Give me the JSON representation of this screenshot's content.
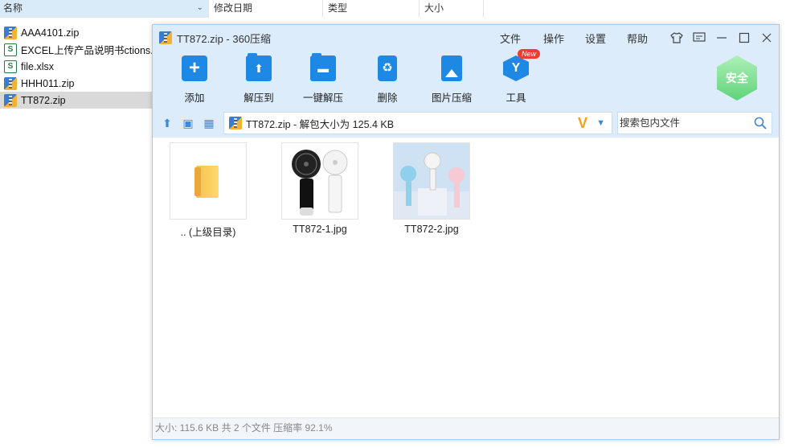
{
  "explorer": {
    "columns": {
      "name": "名称",
      "date": "修改日期",
      "type": "类型",
      "size": "大小"
    },
    "files": [
      {
        "name": "AAA4101.zip",
        "icon": "zip-icon"
      },
      {
        "name": "EXCEL上传产品说明书ctions.xlsx",
        "icon": "xlsx-icon"
      },
      {
        "name": "file.xlsx",
        "icon": "xlsx-icon"
      },
      {
        "name": "HHH011.zip",
        "icon": "zip-icon"
      },
      {
        "name": "TT872.zip",
        "icon": "zip-icon",
        "selected": true
      }
    ]
  },
  "window": {
    "title": "TT872.zip - 360压缩",
    "menu": [
      "文件",
      "操作",
      "设置",
      "帮助"
    ],
    "toolbar": [
      "添加",
      "解压到",
      "一键解压",
      "删除",
      "图片压缩",
      "工具"
    ],
    "new_badge": "New",
    "safe_label": "安全",
    "address": "TT872.zip - 解包大小为 125.4 KB",
    "search_placeholder": "搜索包内文件",
    "items": [
      {
        "label": ".. (上级目录)",
        "kind": "parent-folder"
      },
      {
        "label": "TT872-1.jpg",
        "kind": "image"
      },
      {
        "label": "TT872-2.jpg",
        "kind": "image"
      }
    ],
    "status": "大小: 115.6 KB 共 2 个文件 压缩率 92.1%"
  },
  "colors": {
    "accent": "#1e88e5",
    "titlebar": "#dcecfb",
    "safe": "#5fd37a",
    "badge": "#f03c2e"
  }
}
